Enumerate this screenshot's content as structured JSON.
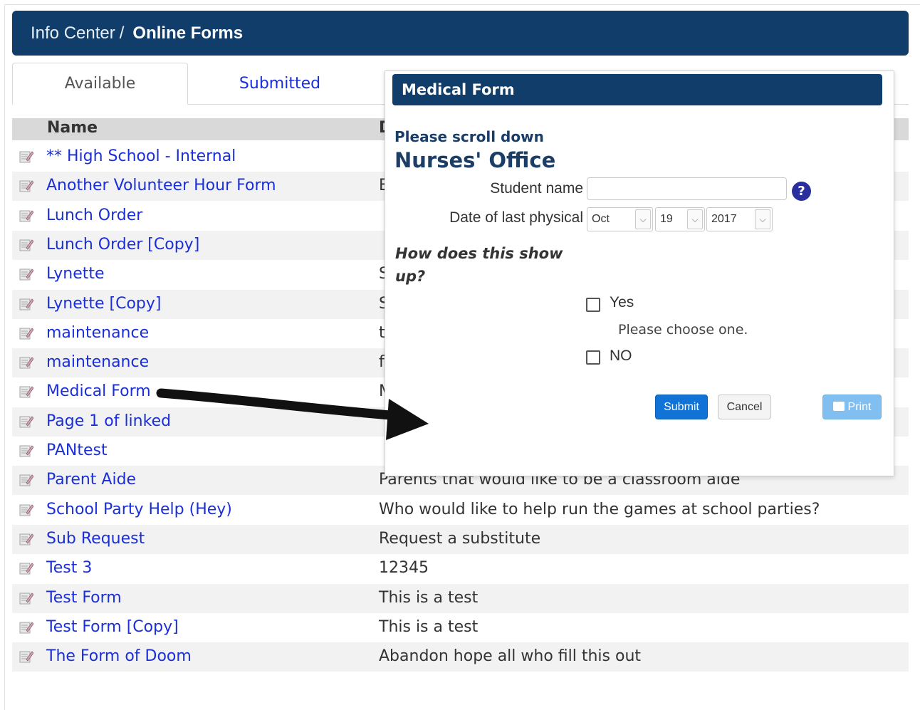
{
  "header": {
    "breadcrumb_link": "Info Center",
    "separator": "/",
    "current": "Online Forms"
  },
  "tabs": [
    {
      "label": "Available",
      "active": true
    },
    {
      "label": "Submitted",
      "active": false
    }
  ],
  "table": {
    "columns": [
      "Name",
      "D"
    ],
    "rows": [
      {
        "name": "** High School - Internal",
        "desc": ""
      },
      {
        "name": "Another Volunteer Hour Form",
        "desc": "E"
      },
      {
        "name": "Lunch Order",
        "desc": ""
      },
      {
        "name": "Lunch Order [Copy]",
        "desc": ""
      },
      {
        "name": "Lynette",
        "desc": "S"
      },
      {
        "name": "Lynette [Copy]",
        "desc": "S"
      },
      {
        "name": "maintenance",
        "desc": "t"
      },
      {
        "name": "maintenance",
        "desc": "f"
      },
      {
        "name": "Medical Form",
        "desc": "M"
      },
      {
        "name": "Page 1 of linked",
        "desc": ""
      },
      {
        "name": "PANtest",
        "desc": ""
      },
      {
        "name": "Parent Aide",
        "desc": "Parents that would like to be a classroom aide"
      },
      {
        "name": "School Party Help (Hey)",
        "desc": "Who would like to help run the games at school parties?"
      },
      {
        "name": "Sub Request",
        "desc": "Request a substitute"
      },
      {
        "name": "Test 3",
        "desc": "12345"
      },
      {
        "name": "Test Form",
        "desc": "This is a test"
      },
      {
        "name": "Test Form [Copy]",
        "desc": "This is a test"
      },
      {
        "name": "The Form of Doom",
        "desc": "Abandon hope all who fill this out"
      }
    ]
  },
  "modal": {
    "title": "Medical Form",
    "scroll_note": "Please scroll down",
    "office": "Nurses' Office",
    "student_label": "Student name",
    "student_value": "",
    "help_glyph": "?",
    "date_label": "Date of last physical",
    "date_month": "Oct",
    "date_day": "19",
    "date_year": "2017",
    "question": "How does this show up?",
    "option_yes": "Yes",
    "choose_note": "Please choose one.",
    "option_no": "NO",
    "submit": "Submit",
    "cancel": "Cancel",
    "print": "Print"
  },
  "colors": {
    "header_bg": "#113d6b",
    "link": "#1a2fd8",
    "submit_bg": "#1273d6",
    "print_bg": "#80bff0"
  }
}
